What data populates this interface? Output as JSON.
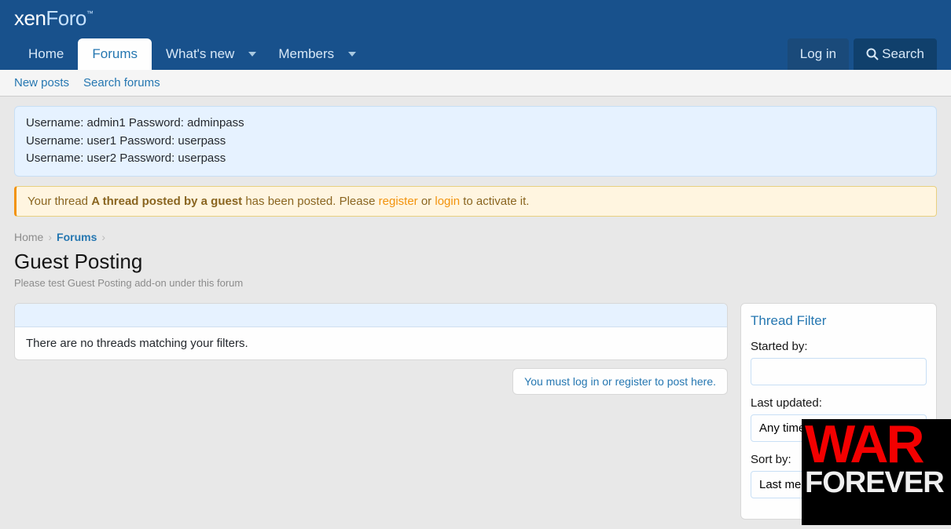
{
  "logo": {
    "part1": "xen",
    "part2": "Foro",
    "tm": "™"
  },
  "nav": {
    "home": "Home",
    "forums": "Forums",
    "whatsnew": "What's new",
    "members": "Members",
    "login": "Log in",
    "search": "Search"
  },
  "subnav": {
    "newposts": "New posts",
    "searchforums": "Search forums"
  },
  "credentials": [
    "Username: admin1 Password: adminpass",
    "Username: user1 Password: userpass",
    "Username: user2 Password: userpass"
  ],
  "alert": {
    "prefix": "Your thread ",
    "title": "A thread posted by a guest",
    "mid": " has been posted. Please ",
    "register": "register",
    "or": " or ",
    "login": "login",
    "suffix": " to activate it."
  },
  "breadcrumbs": {
    "home": "Home",
    "forums": "Forums"
  },
  "page": {
    "title": "Guest Posting",
    "desc": "Please test Guest Posting add-on under this forum"
  },
  "main": {
    "empty": "There are no threads matching your filters.",
    "login_notice": "You must log in or register to post here."
  },
  "filter": {
    "title": "Thread Filter",
    "started_label": "Started by:",
    "started_value": "",
    "updated_label": "Last updated:",
    "updated_value": "Any time",
    "sort_label": "Sort by:",
    "sort_value": "Last me"
  },
  "ad": {
    "line1": "WAR",
    "line2": "FOREVER"
  }
}
